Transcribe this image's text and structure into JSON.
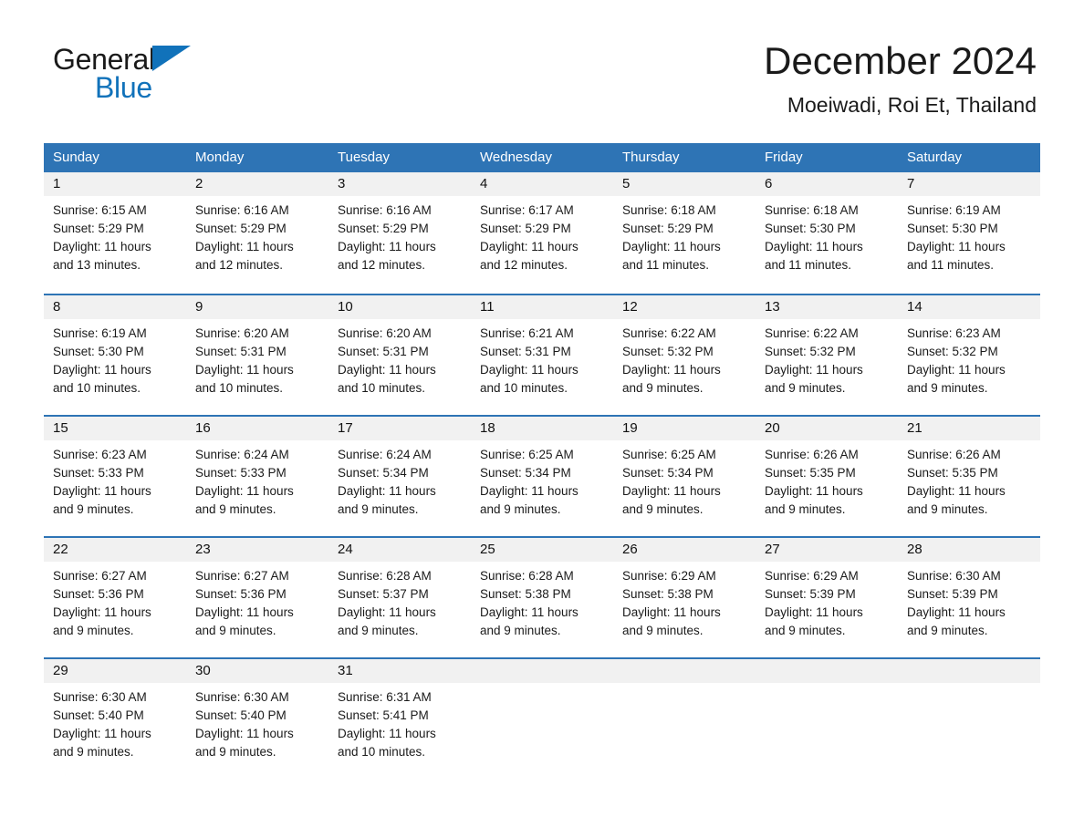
{
  "logo": {
    "word_general": "General",
    "word_blue": "Blue",
    "triangle_color": "#1172BA"
  },
  "header": {
    "title": "December 2024",
    "subtitle": "Moeiwadi, Roi Et, Thailand",
    "accent_color": "#2E74B5",
    "day_band_color": "#F1F1F1"
  },
  "weekdays": [
    "Sunday",
    "Monday",
    "Tuesday",
    "Wednesday",
    "Thursday",
    "Friday",
    "Saturday"
  ],
  "weeks": [
    [
      {
        "day": "1",
        "sunrise": "Sunrise: 6:15 AM",
        "sunset": "Sunset: 5:29 PM",
        "daylight_line1": "Daylight: 11 hours",
        "daylight_line2": "and 13 minutes."
      },
      {
        "day": "2",
        "sunrise": "Sunrise: 6:16 AM",
        "sunset": "Sunset: 5:29 PM",
        "daylight_line1": "Daylight: 11 hours",
        "daylight_line2": "and 12 minutes."
      },
      {
        "day": "3",
        "sunrise": "Sunrise: 6:16 AM",
        "sunset": "Sunset: 5:29 PM",
        "daylight_line1": "Daylight: 11 hours",
        "daylight_line2": "and 12 minutes."
      },
      {
        "day": "4",
        "sunrise": "Sunrise: 6:17 AM",
        "sunset": "Sunset: 5:29 PM",
        "daylight_line1": "Daylight: 11 hours",
        "daylight_line2": "and 12 minutes."
      },
      {
        "day": "5",
        "sunrise": "Sunrise: 6:18 AM",
        "sunset": "Sunset: 5:29 PM",
        "daylight_line1": "Daylight: 11 hours",
        "daylight_line2": "and 11 minutes."
      },
      {
        "day": "6",
        "sunrise": "Sunrise: 6:18 AM",
        "sunset": "Sunset: 5:30 PM",
        "daylight_line1": "Daylight: 11 hours",
        "daylight_line2": "and 11 minutes."
      },
      {
        "day": "7",
        "sunrise": "Sunrise: 6:19 AM",
        "sunset": "Sunset: 5:30 PM",
        "daylight_line1": "Daylight: 11 hours",
        "daylight_line2": "and 11 minutes."
      }
    ],
    [
      {
        "day": "8",
        "sunrise": "Sunrise: 6:19 AM",
        "sunset": "Sunset: 5:30 PM",
        "daylight_line1": "Daylight: 11 hours",
        "daylight_line2": "and 10 minutes."
      },
      {
        "day": "9",
        "sunrise": "Sunrise: 6:20 AM",
        "sunset": "Sunset: 5:31 PM",
        "daylight_line1": "Daylight: 11 hours",
        "daylight_line2": "and 10 minutes."
      },
      {
        "day": "10",
        "sunrise": "Sunrise: 6:20 AM",
        "sunset": "Sunset: 5:31 PM",
        "daylight_line1": "Daylight: 11 hours",
        "daylight_line2": "and 10 minutes."
      },
      {
        "day": "11",
        "sunrise": "Sunrise: 6:21 AM",
        "sunset": "Sunset: 5:31 PM",
        "daylight_line1": "Daylight: 11 hours",
        "daylight_line2": "and 10 minutes."
      },
      {
        "day": "12",
        "sunrise": "Sunrise: 6:22 AM",
        "sunset": "Sunset: 5:32 PM",
        "daylight_line1": "Daylight: 11 hours",
        "daylight_line2": "and 9 minutes."
      },
      {
        "day": "13",
        "sunrise": "Sunrise: 6:22 AM",
        "sunset": "Sunset: 5:32 PM",
        "daylight_line1": "Daylight: 11 hours",
        "daylight_line2": "and 9 minutes."
      },
      {
        "day": "14",
        "sunrise": "Sunrise: 6:23 AM",
        "sunset": "Sunset: 5:32 PM",
        "daylight_line1": "Daylight: 11 hours",
        "daylight_line2": "and 9 minutes."
      }
    ],
    [
      {
        "day": "15",
        "sunrise": "Sunrise: 6:23 AM",
        "sunset": "Sunset: 5:33 PM",
        "daylight_line1": "Daylight: 11 hours",
        "daylight_line2": "and 9 minutes."
      },
      {
        "day": "16",
        "sunrise": "Sunrise: 6:24 AM",
        "sunset": "Sunset: 5:33 PM",
        "daylight_line1": "Daylight: 11 hours",
        "daylight_line2": "and 9 minutes."
      },
      {
        "day": "17",
        "sunrise": "Sunrise: 6:24 AM",
        "sunset": "Sunset: 5:34 PM",
        "daylight_line1": "Daylight: 11 hours",
        "daylight_line2": "and 9 minutes."
      },
      {
        "day": "18",
        "sunrise": "Sunrise: 6:25 AM",
        "sunset": "Sunset: 5:34 PM",
        "daylight_line1": "Daylight: 11 hours",
        "daylight_line2": "and 9 minutes."
      },
      {
        "day": "19",
        "sunrise": "Sunrise: 6:25 AM",
        "sunset": "Sunset: 5:34 PM",
        "daylight_line1": "Daylight: 11 hours",
        "daylight_line2": "and 9 minutes."
      },
      {
        "day": "20",
        "sunrise": "Sunrise: 6:26 AM",
        "sunset": "Sunset: 5:35 PM",
        "daylight_line1": "Daylight: 11 hours",
        "daylight_line2": "and 9 minutes."
      },
      {
        "day": "21",
        "sunrise": "Sunrise: 6:26 AM",
        "sunset": "Sunset: 5:35 PM",
        "daylight_line1": "Daylight: 11 hours",
        "daylight_line2": "and 9 minutes."
      }
    ],
    [
      {
        "day": "22",
        "sunrise": "Sunrise: 6:27 AM",
        "sunset": "Sunset: 5:36 PM",
        "daylight_line1": "Daylight: 11 hours",
        "daylight_line2": "and 9 minutes."
      },
      {
        "day": "23",
        "sunrise": "Sunrise: 6:27 AM",
        "sunset": "Sunset: 5:36 PM",
        "daylight_line1": "Daylight: 11 hours",
        "daylight_line2": "and 9 minutes."
      },
      {
        "day": "24",
        "sunrise": "Sunrise: 6:28 AM",
        "sunset": "Sunset: 5:37 PM",
        "daylight_line1": "Daylight: 11 hours",
        "daylight_line2": "and 9 minutes."
      },
      {
        "day": "25",
        "sunrise": "Sunrise: 6:28 AM",
        "sunset": "Sunset: 5:38 PM",
        "daylight_line1": "Daylight: 11 hours",
        "daylight_line2": "and 9 minutes."
      },
      {
        "day": "26",
        "sunrise": "Sunrise: 6:29 AM",
        "sunset": "Sunset: 5:38 PM",
        "daylight_line1": "Daylight: 11 hours",
        "daylight_line2": "and 9 minutes."
      },
      {
        "day": "27",
        "sunrise": "Sunrise: 6:29 AM",
        "sunset": "Sunset: 5:39 PM",
        "daylight_line1": "Daylight: 11 hours",
        "daylight_line2": "and 9 minutes."
      },
      {
        "day": "28",
        "sunrise": "Sunrise: 6:30 AM",
        "sunset": "Sunset: 5:39 PM",
        "daylight_line1": "Daylight: 11 hours",
        "daylight_line2": "and 9 minutes."
      }
    ],
    [
      {
        "day": "29",
        "sunrise": "Sunrise: 6:30 AM",
        "sunset": "Sunset: 5:40 PM",
        "daylight_line1": "Daylight: 11 hours",
        "daylight_line2": "and 9 minutes."
      },
      {
        "day": "30",
        "sunrise": "Sunrise: 6:30 AM",
        "sunset": "Sunset: 5:40 PM",
        "daylight_line1": "Daylight: 11 hours",
        "daylight_line2": "and 9 minutes."
      },
      {
        "day": "31",
        "sunrise": "Sunrise: 6:31 AM",
        "sunset": "Sunset: 5:41 PM",
        "daylight_line1": "Daylight: 11 hours",
        "daylight_line2": "and 10 minutes."
      },
      {
        "day": "",
        "sunrise": "",
        "sunset": "",
        "daylight_line1": "",
        "daylight_line2": ""
      },
      {
        "day": "",
        "sunrise": "",
        "sunset": "",
        "daylight_line1": "",
        "daylight_line2": ""
      },
      {
        "day": "",
        "sunrise": "",
        "sunset": "",
        "daylight_line1": "",
        "daylight_line2": ""
      },
      {
        "day": "",
        "sunrise": "",
        "sunset": "",
        "daylight_line1": "",
        "daylight_line2": ""
      }
    ]
  ]
}
